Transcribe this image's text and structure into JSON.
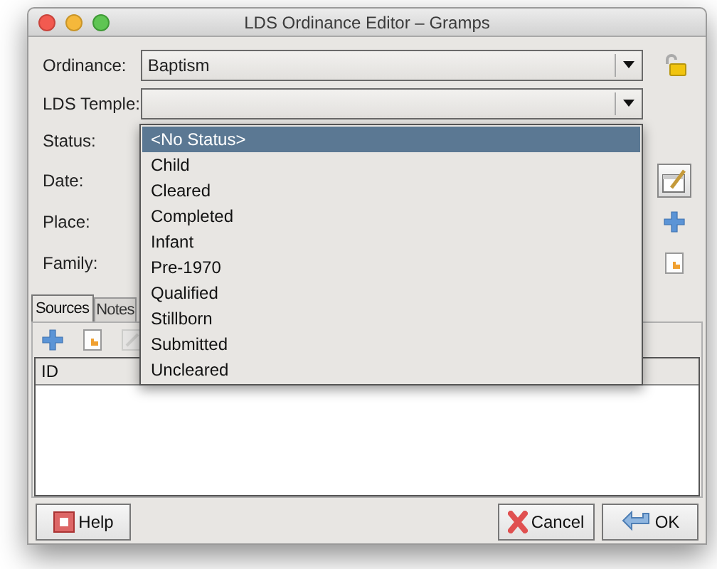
{
  "window": {
    "title": "LDS Ordinance Editor – Gramps"
  },
  "fields": [
    {
      "label": "Ordinance:",
      "kind": "combo",
      "value": "Baptism",
      "tool": {
        "kind": "lock"
      }
    },
    {
      "label": "LDS Temple:",
      "kind": "combo"
    },
    {
      "label": "Status:",
      "kind": "plain"
    },
    {
      "label": "Date:",
      "kind": "plain",
      "tool": {
        "kind": "date"
      }
    },
    {
      "label": "Place:",
      "kind": "plain",
      "tool": {
        "kind": "add"
      }
    },
    {
      "label": "Family:",
      "kind": "plain",
      "tool": {
        "kind": "select"
      }
    }
  ],
  "status_menu": {
    "options": [
      {
        "label": "<No Status>",
        "selected": true
      },
      {
        "label": "Child",
        "selected": false
      },
      {
        "label": "Cleared",
        "selected": false
      },
      {
        "label": "Completed",
        "selected": false
      },
      {
        "label": "Infant",
        "selected": false
      },
      {
        "label": "Pre-1970",
        "selected": false
      },
      {
        "label": "Qualified",
        "selected": false
      },
      {
        "label": "Stillborn",
        "selected": false
      },
      {
        "label": "Submitted",
        "selected": false
      },
      {
        "label": "Uncleared",
        "selected": false
      }
    ]
  },
  "tabs": [
    {
      "label": "Sources",
      "selected": true
    },
    {
      "label": "Notes",
      "selected": false
    }
  ],
  "toolbar": [
    {
      "kind": "add"
    },
    {
      "kind": "select"
    },
    {
      "kind": "edit",
      "disabled": true
    }
  ],
  "table": {
    "columns": [
      "ID"
    ]
  },
  "buttons": [
    {
      "label": "Help",
      "kind": "help"
    },
    {
      "label": "Cancel",
      "kind": "cancel"
    },
    {
      "label": "OK",
      "kind": "ok"
    }
  ]
}
